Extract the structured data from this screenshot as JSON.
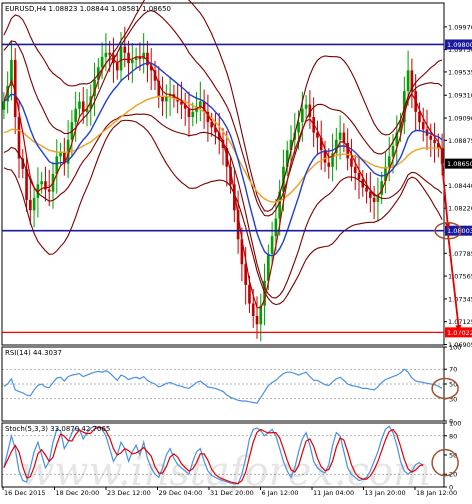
{
  "colors": {
    "frame": "#000000",
    "grid": "#000000",
    "bull": "#00a000",
    "bear": "#c00000",
    "ma_fast": "#c00000",
    "ma_mid": "#1f3fd0",
    "ma_slow": "#f0a020",
    "bands": "#7a0000",
    "level": "#1a1aa0",
    "target": "#ff0000",
    "arrow": "#e00000",
    "circle": "#a0522d",
    "rsi": "#4a90e2",
    "stoch_main": "#4a90e2",
    "stoch_signal": "#e00000",
    "price_box": "#000000",
    "watermark": "#d0d0d0"
  },
  "chart_data": [
    {
      "type": "candlestick",
      "title": "EURUSD,H4  1.08823 1.08844 1.08581 1.08650",
      "y_range": [
        1.069,
        1.102
      ],
      "y_ticks": [
        "1.09970",
        "1.09750",
        "1.09535",
        "1.09310",
        "1.09090",
        "1.08875",
        "1.08440",
        "1.08220",
        "1.07785",
        "1.07565",
        "1.07345",
        "1.07125",
        "1.06905"
      ],
      "y_tick_values": [
        1.0997,
        1.0975,
        1.09535,
        1.0931,
        1.0909,
        1.08875,
        1.0844,
        1.0822,
        1.07785,
        1.07565,
        1.07345,
        1.07125,
        1.06905
      ],
      "price_labels": [
        {
          "text": "1.09800",
          "value": 1.098,
          "kind": "level"
        },
        {
          "text": "1.08650",
          "value": 1.0865,
          "kind": "price"
        },
        {
          "text": "1.08003",
          "value": 1.08003,
          "kind": "level"
        },
        {
          "text": "1.07022",
          "value": 1.07022,
          "kind": "target"
        }
      ],
      "levels": [
        1.098,
        1.08003
      ],
      "target_level": 1.07022,
      "x_labels": [
        "16 Dec 2015",
        "18 Dec 20:00",
        "23 Dec 12:00",
        "29 Dec 04:00",
        "31 Dec 20:00",
        "6 Jan 12:00",
        "11 Jan 04:00",
        "13 Jan 20:00",
        "18 Jan 12:00"
      ],
      "closes": [
        1.0925,
        1.094,
        1.0965,
        1.091,
        1.087,
        1.086,
        1.083,
        1.082,
        1.0832,
        1.0845,
        1.0848,
        1.084,
        1.0838,
        1.0855,
        1.0872,
        1.0876,
        1.0865,
        1.0888,
        1.0905,
        1.0918,
        1.0925,
        1.0915,
        1.0918,
        1.093,
        1.0946,
        1.0958,
        1.0968,
        1.0972,
        1.097,
        1.0962,
        1.0955,
        1.0978,
        1.0972,
        1.0962,
        1.0965,
        1.0968,
        1.0966,
        1.0972,
        1.096,
        1.0955,
        1.0945,
        1.093,
        1.0925,
        1.093,
        1.0932,
        1.0928,
        1.0925,
        1.0922,
        1.0918,
        1.091,
        1.0915,
        1.092,
        1.0925,
        1.0915,
        1.0905,
        1.09,
        1.0895,
        1.0888,
        1.088,
        1.0862,
        1.0845,
        1.082,
        1.0792,
        1.0768,
        1.0748,
        1.073,
        1.0718,
        1.071,
        1.0728,
        1.0752,
        1.0778,
        1.0795,
        1.0812,
        1.0838,
        1.0862,
        1.0878,
        1.0888,
        1.0895,
        1.0905,
        1.0918,
        1.0922,
        1.091,
        1.0895,
        1.089,
        1.0878,
        1.0866,
        1.0862,
        1.0875,
        1.0888,
        1.0895,
        1.0885,
        1.087,
        1.0862,
        1.0856,
        1.085,
        1.0842,
        1.0838,
        1.0832,
        1.0828,
        1.0835,
        1.0848,
        1.0862,
        1.0872,
        1.0882,
        1.0895,
        1.0905,
        1.0935,
        1.0955,
        1.0935,
        1.0915,
        1.0905,
        1.0898,
        1.0892,
        1.0888,
        1.0885,
        1.088,
        1.0865
      ],
      "ma_fast": [
        1.0925,
        1.0935,
        1.0945,
        1.0935,
        1.0915,
        1.0895,
        1.0872,
        1.0852,
        1.0842,
        1.0838,
        1.0841,
        1.0842,
        1.0842,
        1.0846,
        1.0855,
        1.0863,
        1.0866,
        1.0873,
        1.0885,
        1.0898,
        1.091,
        1.0915,
        1.0918,
        1.0925,
        1.0935,
        1.0945,
        1.0955,
        1.0962,
        1.0966,
        1.0966,
        1.0962,
        1.0965,
        1.0966,
        1.0965,
        1.0966,
        1.0968,
        1.0968,
        1.0968,
        1.0965,
        1.096,
        1.0952,
        1.0942,
        1.0935,
        1.0932,
        1.0932,
        1.093,
        1.0928,
        1.0926,
        1.0922,
        1.0918,
        1.0917,
        1.0918,
        1.092,
        1.0918,
        1.0912,
        1.0906,
        1.09,
        1.0894,
        1.0886,
        1.0872,
        1.0858,
        1.0838,
        1.0815,
        1.0792,
        1.0772,
        1.0752,
        1.0738,
        1.0726,
        1.0726,
        1.0734,
        1.075,
        1.0768,
        1.0786,
        1.0806,
        1.0828,
        1.0848,
        1.0866,
        1.0878,
        1.0888,
        1.0898,
        1.0906,
        1.0908,
        1.0903,
        1.0897,
        1.0889,
        1.0879,
        1.0871,
        1.0872,
        1.0878,
        1.0886,
        1.0886,
        1.0881,
        1.0874,
        1.0866,
        1.0859,
        1.0852,
        1.0845,
        1.0839,
        1.0834,
        1.0834,
        1.0839,
        1.0848,
        1.0859,
        1.0869,
        1.088,
        1.0892,
        1.0911,
        1.0929,
        1.0932,
        1.0926,
        1.0917,
        1.0909,
        1.0902,
        1.0896,
        1.0891,
        1.0886,
        1.0877
      ],
      "ma_mid": [
        1.0925,
        1.0928,
        1.0932,
        1.0931,
        1.0926,
        1.0919,
        1.0909,
        1.0898,
        1.0889,
        1.0882,
        1.0877,
        1.0872,
        1.0867,
        1.0865,
        1.0865,
        1.0866,
        1.0866,
        1.0868,
        1.0872,
        1.0877,
        1.0883,
        1.0888,
        1.0892,
        1.0897,
        1.0904,
        1.0911,
        1.0918,
        1.0925,
        1.0931,
        1.0936,
        1.094,
        1.0945,
        1.0948,
        1.0951,
        1.0954,
        1.0957,
        1.0959,
        1.0961,
        1.0962,
        1.0962,
        1.096,
        1.0957,
        1.0954,
        1.0951,
        1.0948,
        1.0945,
        1.0942,
        1.0939,
        1.0936,
        1.0932,
        1.093,
        1.0928,
        1.0927,
        1.0925,
        1.0922,
        1.0919,
        1.0915,
        1.0911,
        1.0906,
        1.09,
        1.0892,
        1.0881,
        1.0869,
        1.0855,
        1.0841,
        1.0826,
        1.0812,
        1.0798,
        1.0788,
        1.078,
        1.0777,
        1.0776,
        1.0778,
        1.0783,
        1.079,
        1.08,
        1.0811,
        1.0822,
        1.0833,
        1.0845,
        1.0856,
        1.0864,
        1.087,
        1.0874,
        1.0876,
        1.0877,
        1.0877,
        1.0878,
        1.088,
        1.0882,
        1.0882,
        1.0881,
        1.0879,
        1.0876,
        1.0872,
        1.0868,
        1.0864,
        1.086,
        1.0856,
        1.0854,
        1.0853,
        1.0854,
        1.0856,
        1.086,
        1.0865,
        1.0871,
        1.088,
        1.089,
        1.0895,
        1.0897,
        1.0897,
        1.0896,
        1.0895,
        1.0894,
        1.0892,
        1.0891,
        1.0888
      ],
      "ma_slow": [
        1.0895,
        1.0896,
        1.0898,
        1.0898,
        1.0897,
        1.0895,
        1.0892,
        1.0889,
        1.0886,
        1.0884,
        1.0882,
        1.088,
        1.0878,
        1.0877,
        1.0876,
        1.0876,
        1.0876,
        1.0876,
        1.0877,
        1.0878,
        1.088,
        1.0882,
        1.0884,
        1.0886,
        1.0889,
        1.0892,
        1.0895,
        1.0898,
        1.0901,
        1.0904,
        1.0907,
        1.091,
        1.0913,
        1.0916,
        1.0918,
        1.0921,
        1.0923,
        1.0925,
        1.0927,
        1.0928,
        1.0929,
        1.093,
        1.093,
        1.093,
        1.0929,
        1.0928,
        1.0927,
        1.0926,
        1.0925,
        1.0923,
        1.0921,
        1.0919,
        1.0917,
        1.0915,
        1.0912,
        1.0909,
        1.0905,
        1.0901,
        1.0896,
        1.0891,
        1.0885,
        1.0878,
        1.087,
        1.0863,
        1.0856,
        1.0849,
        1.0843,
        1.0838,
        1.0834,
        1.0831,
        1.0829,
        1.0828,
        1.0828,
        1.0829,
        1.0831,
        1.0834,
        1.0837,
        1.0841,
        1.0845,
        1.085,
        1.0855,
        1.0859,
        1.0863,
        1.0866,
        1.0868,
        1.087,
        1.0871,
        1.0872,
        1.0873,
        1.0874,
        1.0874,
        1.0874,
        1.0873,
        1.0872,
        1.0871,
        1.0869,
        1.0867,
        1.0865,
        1.0863,
        1.0862,
        1.0861,
        1.0861,
        1.0861,
        1.0862,
        1.0864,
        1.0866,
        1.0869,
        1.0873,
        1.0876,
        1.0878,
        1.0879,
        1.088,
        1.088,
        1.088,
        1.088,
        1.088,
        1.0879
      ]
    },
    {
      "type": "line",
      "title": "RSI(14) 44.3037",
      "y_range": [
        0,
        100
      ],
      "y_ticks": [
        100,
        70,
        50,
        30,
        0
      ],
      "values": [
        47,
        50,
        57,
        42,
        40,
        38,
        35,
        34,
        42,
        48,
        50,
        46,
        45,
        52,
        58,
        59,
        54,
        60,
        62,
        63,
        64,
        60,
        62,
        64,
        66,
        67,
        66,
        68,
        65,
        60,
        55,
        62,
        60,
        56,
        58,
        59,
        57,
        60,
        55,
        52,
        50,
        46,
        48,
        51,
        52,
        50,
        48,
        47,
        45,
        44,
        48,
        52,
        54,
        50,
        46,
        45,
        44,
        42,
        40,
        35,
        32,
        30,
        28,
        27,
        27,
        26,
        25,
        24,
        32,
        40,
        48,
        52,
        55,
        60,
        64,
        66,
        66,
        64,
        62,
        64,
        66,
        60,
        55,
        55,
        52,
        49,
        48,
        53,
        57,
        59,
        55,
        50,
        48,
        47,
        46,
        44,
        44,
        43,
        42,
        46,
        52,
        56,
        58,
        60,
        62,
        65,
        70,
        66,
        58,
        54,
        53,
        52,
        51,
        50,
        49,
        47,
        44
      ]
    },
    {
      "type": "line",
      "title": "Stoch(5,3,3) 33.0870 42.7065",
      "y_range": [
        0,
        100
      ],
      "y_ticks": [
        100,
        80,
        50,
        20,
        0
      ],
      "main": [
        30,
        55,
        80,
        60,
        25,
        10,
        8,
        30,
        55,
        70,
        50,
        30,
        40,
        70,
        90,
        88,
        60,
        70,
        85,
        92,
        90,
        75,
        85,
        92,
        95,
        93,
        90,
        80,
        60,
        40,
        50,
        70,
        60,
        40,
        55,
        65,
        50,
        70,
        45,
        30,
        20,
        15,
        30,
        50,
        60,
        45,
        35,
        30,
        25,
        20,
        40,
        55,
        60,
        40,
        25,
        18,
        15,
        12,
        10,
        8,
        6,
        5,
        5,
        20,
        45,
        75,
        90,
        92,
        88,
        80,
        85,
        90,
        80,
        60,
        40,
        25,
        15,
        30,
        55,
        75,
        85,
        65,
        40,
        30,
        25,
        22,
        35,
        65,
        85,
        80,
        55,
        30,
        20,
        15,
        10,
        12,
        15,
        25,
        40,
        55,
        75,
        90,
        95,
        85,
        65,
        40,
        25,
        20,
        25,
        35,
        38,
        33
      ]
    }
  ],
  "watermark": "www.instaforex.com"
}
